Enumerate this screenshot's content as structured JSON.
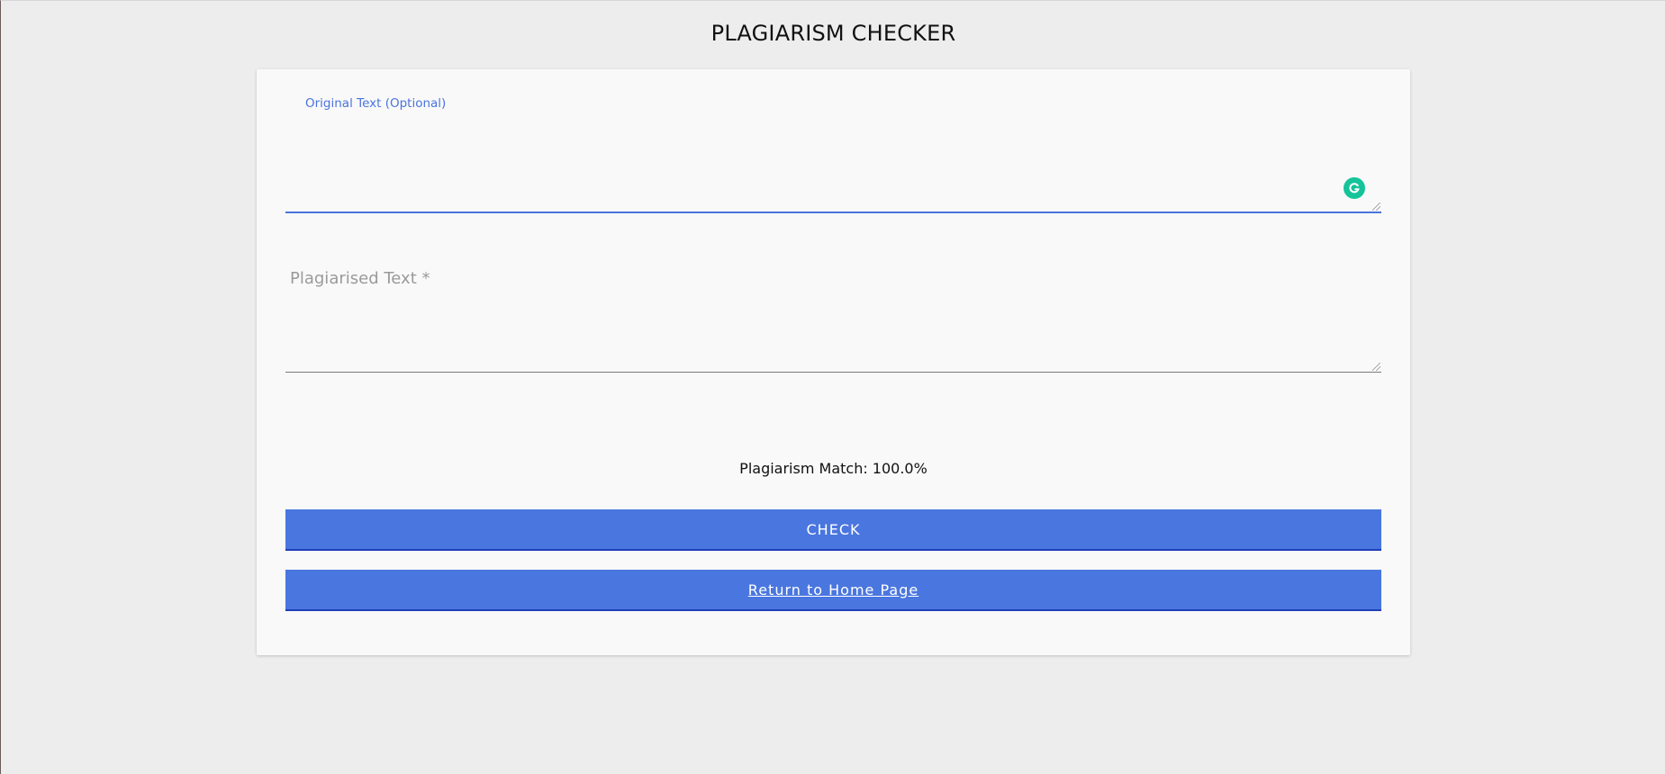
{
  "header": {
    "title": "PLAGIARISM CHECKER"
  },
  "form": {
    "original_label": "Original Text (Optional)",
    "original_value": "",
    "plagiarised_label": "Plagiarised Text *",
    "plagiarised_value": ""
  },
  "result": {
    "text": "Plagiarism Match: 100.0%"
  },
  "buttons": {
    "check_label": "CHECK",
    "home_label": "Return to Home Page"
  },
  "icons": {
    "grammarly": "grammarly-icon",
    "resize": "resize-grip-icon"
  },
  "colors": {
    "accent": "#4a76df",
    "grammarly": "#15c39a",
    "background": "#ededed",
    "card": "#f9f9f9"
  }
}
